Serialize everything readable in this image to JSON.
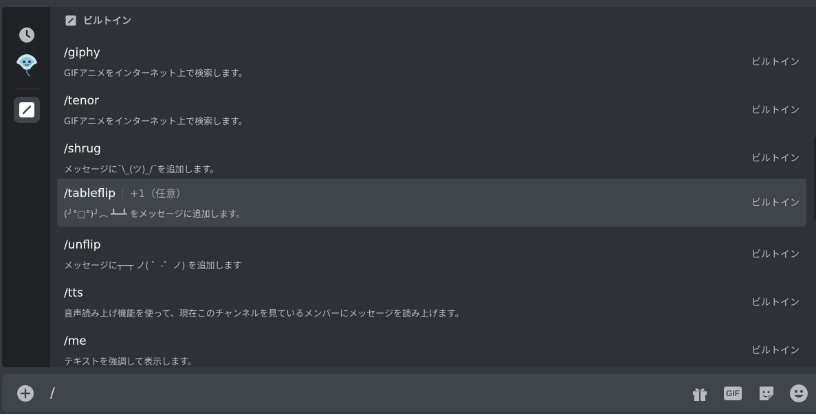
{
  "popup": {
    "section_title": "ビルトイン",
    "commands": [
      {
        "name": "/giphy",
        "option": "",
        "description": "GIFアニメをインターネット上で検索します。",
        "source": "ビルトイン",
        "active": false
      },
      {
        "name": "/tenor",
        "option": "",
        "description": "GIFアニメをインターネット上で検索します。",
        "source": "ビルトイン",
        "active": false
      },
      {
        "name": "/shrug",
        "option": "",
        "description": "メッセージに¯\\_(ツ)_/¯を追加します。",
        "source": "ビルトイン",
        "active": false
      },
      {
        "name": "/tableflip",
        "option": "+1（任意）",
        "description": "(╯°□°)╯︵ ┻━┻ をメッセージに追加します。",
        "source": "ビルトイン",
        "active": true
      },
      {
        "name": "/unflip",
        "option": "",
        "description": "メッセージに┬─┬ ノ( ゜-゜ノ) を追加します",
        "source": "ビルトイン",
        "active": false
      },
      {
        "name": "/tts",
        "option": "",
        "description": "音声読み上げ機能を使って、現在このチャンネルを見ているメンバーにメッセージを読み上げます。",
        "source": "ビルトイン",
        "active": false
      },
      {
        "name": "/me",
        "option": "",
        "description": "テキストを強調して表示します。",
        "source": "ビルトイン",
        "active": false
      }
    ]
  },
  "rail": {
    "items": [
      {
        "icon": "clock-icon"
      },
      {
        "icon": "bot-avatar-icon"
      },
      {
        "icon": "builtin-slash-icon"
      }
    ]
  },
  "composer": {
    "value": "/",
    "buttons": [
      "gift-icon",
      "gif-icon",
      "sticker-icon",
      "emoji-icon"
    ],
    "gif_label": "GIF"
  },
  "colors": {
    "background": "#36393f",
    "popup": "#2f3136",
    "rail": "#202225",
    "active_row": "#40444b",
    "text": "#ffffff",
    "muted": "#b9bbbe"
  }
}
